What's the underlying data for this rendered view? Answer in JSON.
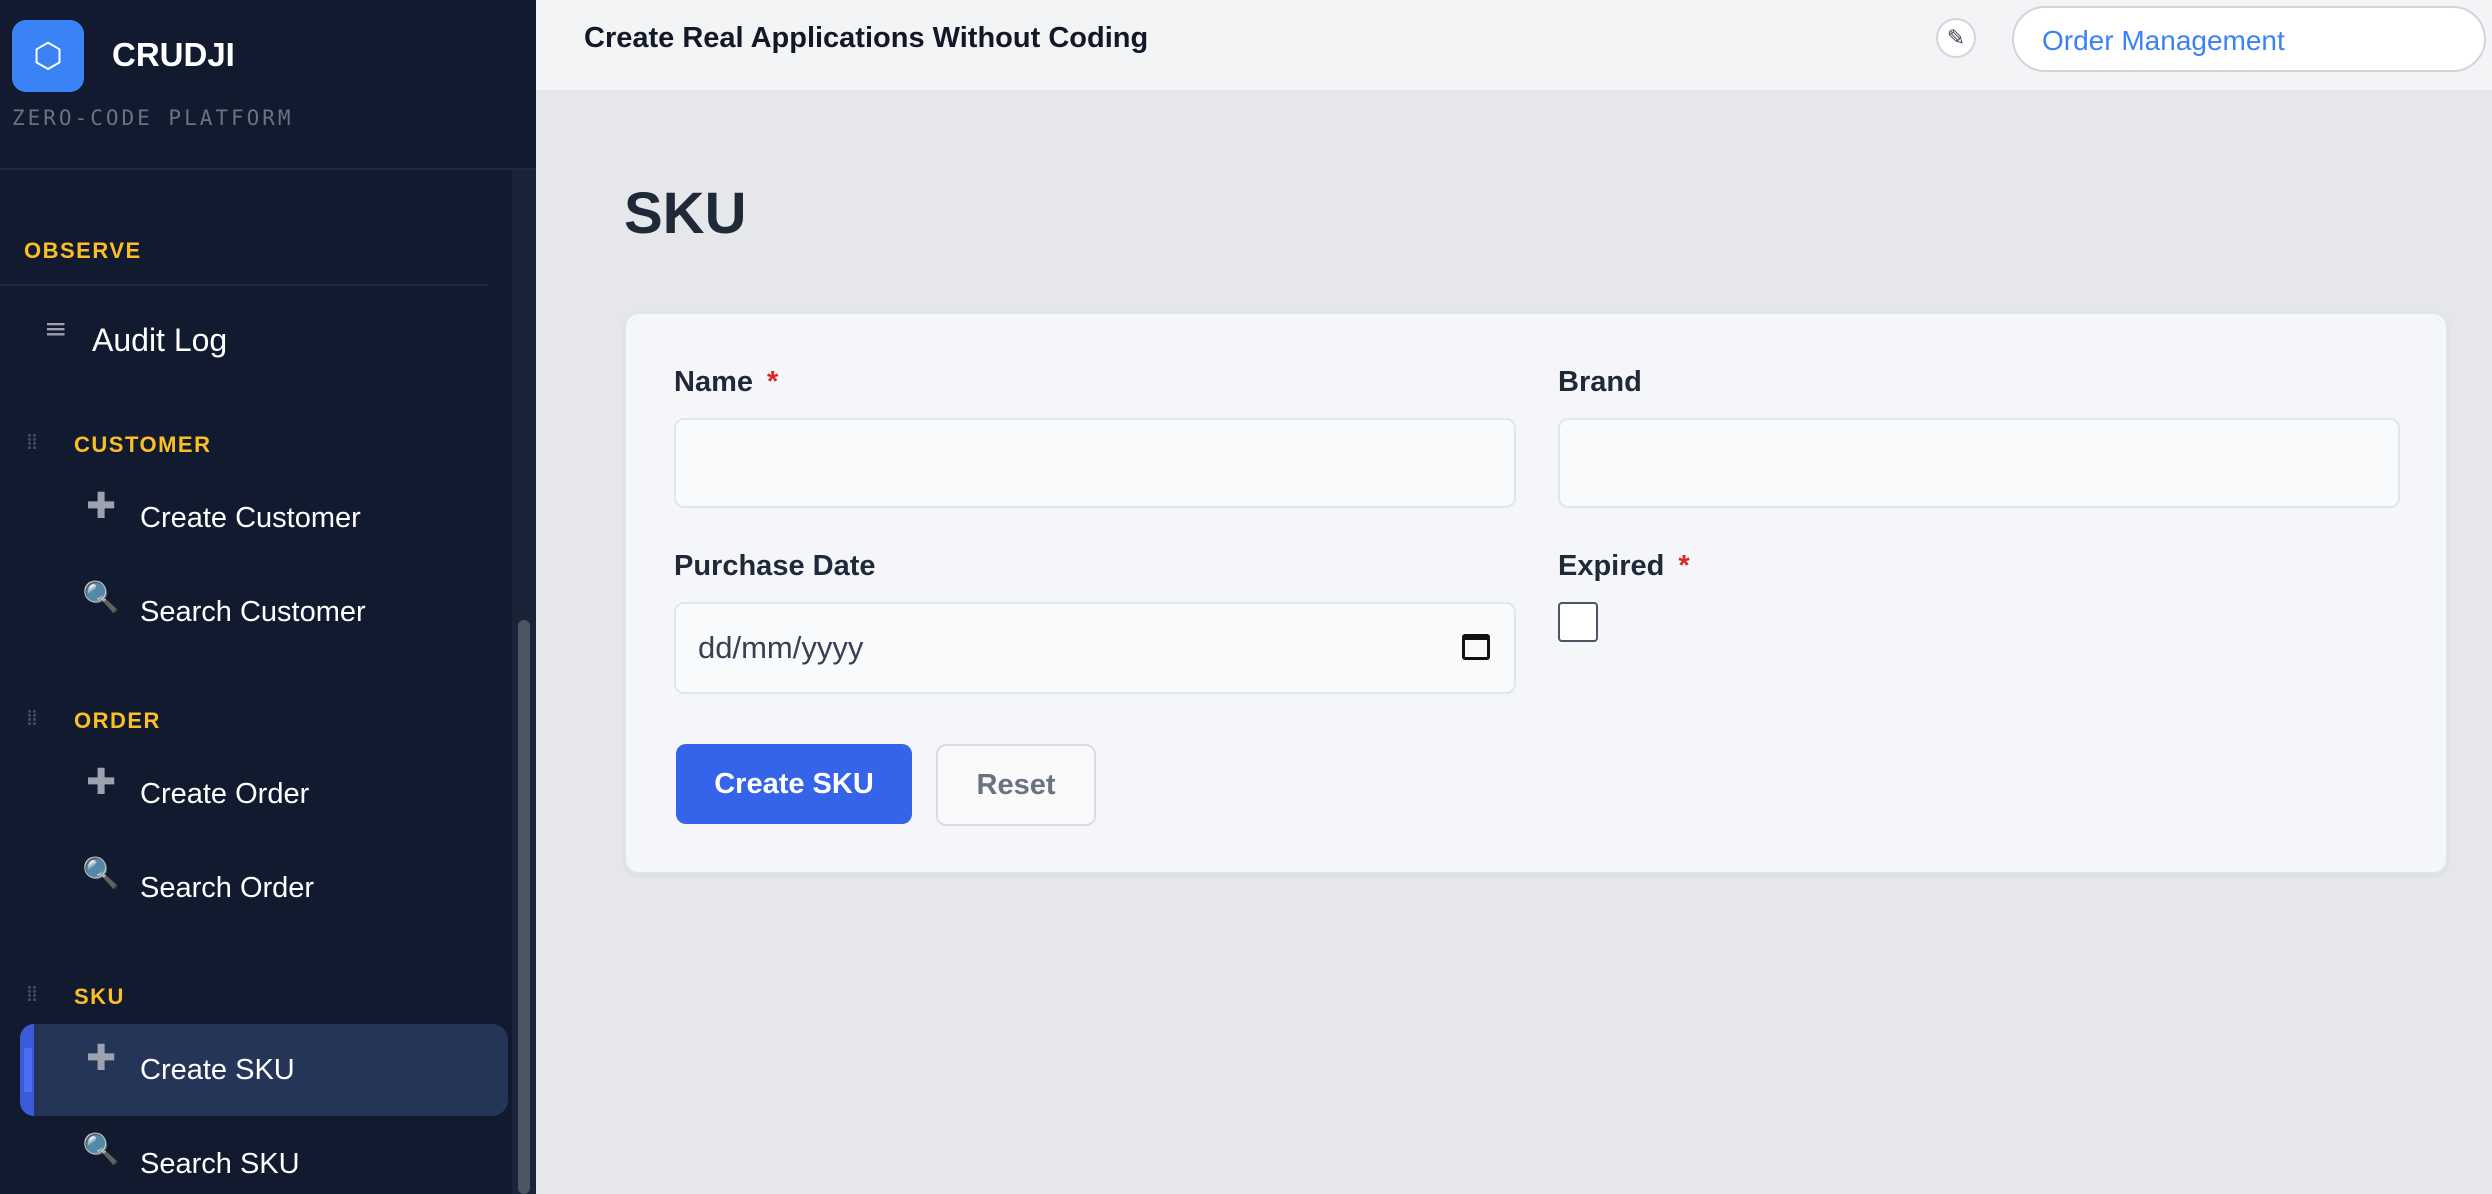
{
  "brand": {
    "logo_glyph": "⬡",
    "name": "CRUDJI",
    "tagline": "ZERO-CODE PLATFORM"
  },
  "sidebar": {
    "observe": {
      "title": "OBSERVE",
      "audit_label": "Audit Log",
      "audit_icon": "menu-icon"
    },
    "groups": [
      {
        "title": "CUSTOMER",
        "items": [
          {
            "label": "Create Customer",
            "icon": "plus-icon",
            "glyph": "✚"
          },
          {
            "label": "Search Customer",
            "icon": "magnifier-icon",
            "glyph": "🔍"
          }
        ]
      },
      {
        "title": "ORDER",
        "items": [
          {
            "label": "Create Order",
            "icon": "plus-icon",
            "glyph": "✚"
          },
          {
            "label": "Search Order",
            "icon": "magnifier-icon",
            "glyph": "🔍"
          }
        ]
      },
      {
        "title": "SKU",
        "items": [
          {
            "label": "Create SKU",
            "icon": "plus-icon",
            "glyph": "✚",
            "active": true
          },
          {
            "label": "Search SKU",
            "icon": "magnifier-icon",
            "glyph": "🔍"
          }
        ]
      }
    ]
  },
  "topbar": {
    "title": "Create Real Applications Without Coding",
    "project": "Order Management",
    "edit_glyph": "✎"
  },
  "page": {
    "title": "SKU"
  },
  "form": {
    "fields": {
      "name": {
        "label": "Name",
        "required_mark": "*",
        "value": ""
      },
      "brand": {
        "label": "Brand",
        "value": ""
      },
      "purchase_date": {
        "label": "Purchase Date",
        "placeholder": "dd/mm/yyyy"
      },
      "expired": {
        "label": "Expired",
        "required_mark": "*",
        "checked": false
      }
    },
    "submit_label": "Create SKU",
    "reset_label": "Reset"
  },
  "colors": {
    "accent": "#3563e9",
    "sidebar_bg": "#111a2e",
    "section_title": "#fbbf24",
    "required": "#dc2626"
  }
}
